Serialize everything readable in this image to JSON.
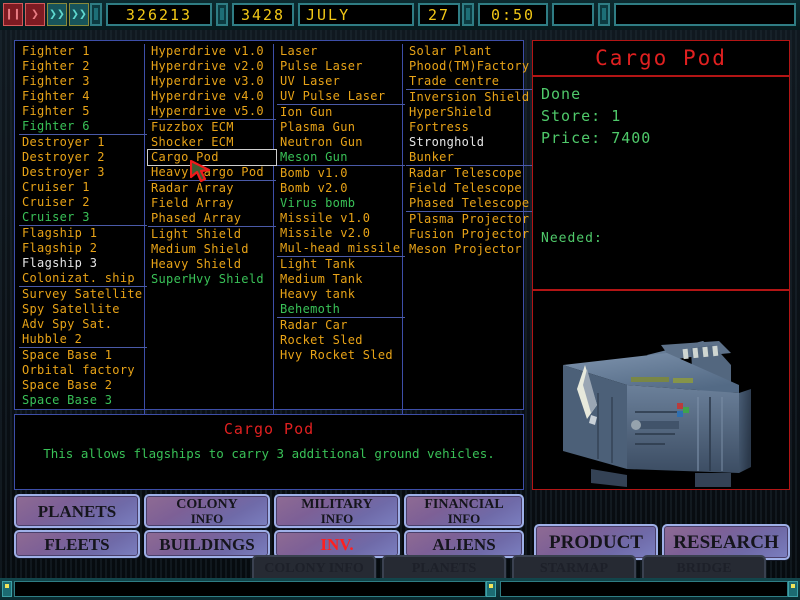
{
  "topbar": {
    "buttons": [
      {
        "name": "pause-button",
        "glyph": "❙❙",
        "kind": "red"
      },
      {
        "name": "play-button",
        "glyph": "❯",
        "kind": "red"
      },
      {
        "name": "fast-forward-button",
        "glyph": "❯❯",
        "kind": "teal"
      },
      {
        "name": "very-fast-forward-button",
        "glyph": "❯❯",
        "kind": "teal"
      }
    ],
    "credits": "326213",
    "year": "3428",
    "month": "JULY",
    "day": "27",
    "clock": "0:50"
  },
  "columns": [
    {
      "id": "ships",
      "items": [
        {
          "label": "Fighter 1",
          "color": "orange"
        },
        {
          "label": "Fighter 2",
          "color": "orange"
        },
        {
          "label": "Fighter 3",
          "color": "orange"
        },
        {
          "label": "Fighter 4",
          "color": "orange"
        },
        {
          "label": "Fighter 5",
          "color": "orange"
        },
        {
          "label": "Fighter 6",
          "color": "green"
        },
        {
          "label": "Destroyer 1",
          "color": "orange",
          "sep": true
        },
        {
          "label": "Destroyer 2",
          "color": "orange"
        },
        {
          "label": "Destroyer 3",
          "color": "orange"
        },
        {
          "label": "Cruiser 1",
          "color": "orange"
        },
        {
          "label": "Cruiser 2",
          "color": "orange"
        },
        {
          "label": "Cruiser 3",
          "color": "green"
        },
        {
          "label": "Flagship 1",
          "color": "orange",
          "sep": true
        },
        {
          "label": "Flagship 2",
          "color": "orange"
        },
        {
          "label": "Flagship 3",
          "color": "white"
        },
        {
          "label": "Colonizat. ship",
          "color": "orange"
        },
        {
          "label": "Survey Satellite",
          "color": "orange",
          "sep": true
        },
        {
          "label": "Spy Satellite",
          "color": "orange"
        },
        {
          "label": "Adv Spy Sat.",
          "color": "orange"
        },
        {
          "label": "Hubble 2",
          "color": "orange"
        },
        {
          "label": "Space Base 1",
          "color": "orange",
          "sep": true
        },
        {
          "label": "Orbital factory",
          "color": "orange"
        },
        {
          "label": "Space Base 2",
          "color": "orange"
        },
        {
          "label": "Space Base 3",
          "color": "green"
        }
      ]
    },
    {
      "id": "systems",
      "items": [
        {
          "label": "Hyperdrive v1.0",
          "color": "orange"
        },
        {
          "label": "Hyperdrive v2.0",
          "color": "orange"
        },
        {
          "label": "Hyperdrive v3.0",
          "color": "orange"
        },
        {
          "label": "Hyperdrive v4.0",
          "color": "orange"
        },
        {
          "label": "Hyperdrive v5.0",
          "color": "orange"
        },
        {
          "label": "Fuzzbox ECM",
          "color": "orange",
          "sep": true
        },
        {
          "label": "Shocker ECM",
          "color": "orange"
        },
        {
          "label": "Cargo Pod",
          "color": "orange",
          "selected": true
        },
        {
          "label": "Heavy Cargo Pod",
          "color": "orange"
        },
        {
          "label": "Radar Array",
          "color": "orange",
          "sep": true
        },
        {
          "label": "Field Array",
          "color": "orange"
        },
        {
          "label": "Phased Array",
          "color": "orange"
        },
        {
          "label": "Light Shield",
          "color": "orange",
          "sep": true
        },
        {
          "label": "Medium Shield",
          "color": "orange"
        },
        {
          "label": "Heavy Shield",
          "color": "orange"
        },
        {
          "label": "SuperHvy Shield",
          "color": "green"
        }
      ]
    },
    {
      "id": "weapons",
      "items": [
        {
          "label": "Laser",
          "color": "orange"
        },
        {
          "label": "Pulse Laser",
          "color": "orange"
        },
        {
          "label": "UV Laser",
          "color": "orange"
        },
        {
          "label": "UV Pulse Laser",
          "color": "orange"
        },
        {
          "label": "Ion Gun",
          "color": "orange",
          "sep": true
        },
        {
          "label": "Plasma Gun",
          "color": "orange"
        },
        {
          "label": "Neutron Gun",
          "color": "orange"
        },
        {
          "label": "Meson Gun",
          "color": "green"
        },
        {
          "label": "Bomb v1.0",
          "color": "orange",
          "sep": true
        },
        {
          "label": "Bomb v2.0",
          "color": "orange"
        },
        {
          "label": "Virus bomb",
          "color": "green"
        },
        {
          "label": "Missile v1.0",
          "color": "orange"
        },
        {
          "label": "Missile v2.0",
          "color": "orange"
        },
        {
          "label": "Mul-head missile",
          "color": "orange"
        },
        {
          "label": "Light Tank",
          "color": "orange",
          "sep": true
        },
        {
          "label": "Medium Tank",
          "color": "orange"
        },
        {
          "label": "Heavy tank",
          "color": "orange"
        },
        {
          "label": "Behemoth",
          "color": "green"
        },
        {
          "label": "Radar Car",
          "color": "orange",
          "sep": true
        },
        {
          "label": "Rocket Sled",
          "color": "orange"
        },
        {
          "label": "Hvy Rocket Sled",
          "color": "orange"
        }
      ]
    },
    {
      "id": "buildings",
      "items": [
        {
          "label": "Solar Plant",
          "color": "orange"
        },
        {
          "label": "Phood(TM)Factory",
          "color": "orange"
        },
        {
          "label": "Trade centre",
          "color": "orange"
        },
        {
          "label": "Inversion Shield",
          "color": "orange",
          "sep": true
        },
        {
          "label": "HyperShield",
          "color": "orange"
        },
        {
          "label": "Fortress",
          "color": "orange"
        },
        {
          "label": "Stronghold",
          "color": "white"
        },
        {
          "label": "Bunker",
          "color": "orange"
        },
        {
          "label": "Radar Telescope",
          "color": "orange",
          "sep": true
        },
        {
          "label": "Field Telescope",
          "color": "orange"
        },
        {
          "label": "Phased Telescope",
          "color": "orange"
        },
        {
          "label": "Plasma Projector",
          "color": "orange",
          "sep": true
        },
        {
          "label": "Fusion Projector",
          "color": "orange"
        },
        {
          "label": "Meson Projector",
          "color": "orange"
        }
      ]
    }
  ],
  "description": {
    "title": "Cargo Pod",
    "body": "This allows flagships to carry 3 additional ground vehicles."
  },
  "detail": {
    "title": "Cargo Pod",
    "status": "Done",
    "store_label": "Store: 1",
    "price_label": "Price: 7400",
    "needed_label": "Needed:",
    "art_name": "cargo-pod-render"
  },
  "nav_buttons": [
    {
      "name": "planets-button",
      "lines": [
        "PLANETS"
      ],
      "active": false
    },
    {
      "name": "colony-info-button",
      "lines": [
        "COLONY",
        "INFO"
      ],
      "active": false
    },
    {
      "name": "military-info-button",
      "lines": [
        "MILITARY",
        "INFO"
      ],
      "active": false
    },
    {
      "name": "financial-info-button",
      "lines": [
        "FINANCIAL",
        "INFO"
      ],
      "active": false
    },
    {
      "name": "fleets-button",
      "lines": [
        "FLEETS"
      ],
      "active": false
    },
    {
      "name": "buildings-button",
      "lines": [
        "BUILDINGS"
      ],
      "active": false
    },
    {
      "name": "inventory-button",
      "lines": [
        "INV."
      ],
      "active": true
    },
    {
      "name": "aliens-button",
      "lines": [
        "ALIENS"
      ],
      "active": false
    }
  ],
  "side_buttons": [
    {
      "name": "product-button",
      "label": "PRODUCT"
    },
    {
      "name": "research-button",
      "label": "RESEARCH"
    }
  ],
  "background_buttons": [
    {
      "name": "bg-colony-info-button",
      "label": "COLONY INFO"
    },
    {
      "name": "bg-planets-button",
      "label": "PLANETS"
    },
    {
      "name": "bg-starmap-button",
      "label": "STARMAP"
    },
    {
      "name": "bg-bridge-button",
      "label": "BRIDGE"
    }
  ],
  "colors": {
    "orange": "#e8a317",
    "green": "#39c157",
    "white": "#e6e6e6",
    "red": "#e02020",
    "panel_border": "#3d4ea8",
    "detail_border": "#b31515",
    "segment_yellow": "#f2c716"
  }
}
